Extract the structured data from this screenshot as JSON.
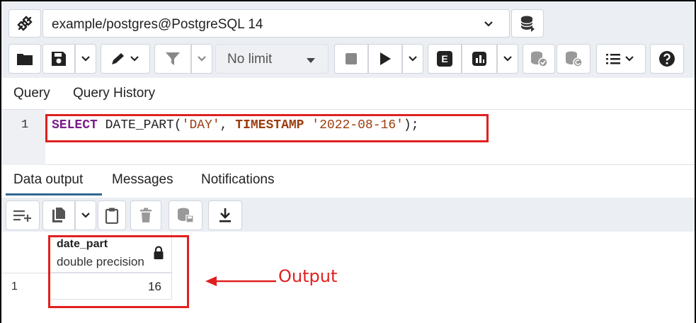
{
  "connection": {
    "label": "example/postgres@PostgreSQL 14",
    "icons": {
      "plug": "disconnect-plug-icon",
      "chevron": "chevron-down-icon",
      "db": "database-icon"
    }
  },
  "toolbar": {
    "limit_label": "No limit",
    "icons": [
      "folder-icon",
      "save-icon",
      "chevron-down-icon",
      "edit-pen-icon",
      "filter-icon",
      "stop-icon",
      "play-icon",
      "explain-icon",
      "explain-analyze-icon",
      "commit-icon",
      "rollback-icon",
      "macros-icon",
      "help-icon"
    ],
    "explain_label": "E"
  },
  "query_tabs": {
    "query": "Query",
    "history": "Query History"
  },
  "editor": {
    "line_number": "1",
    "sql": {
      "select_kw": "SELECT",
      "fn": " DATE_PART(",
      "arg1": "'DAY'",
      "comma": ", ",
      "ts_kw": "TIMESTAMP",
      "space": " ",
      "arg2": "'2022-08-16'",
      "close": ");"
    }
  },
  "result_tabs": {
    "data_output": "Data output",
    "messages": "Messages",
    "notifications": "Notifications"
  },
  "result_toolbar": {
    "icons": [
      "add-row-icon",
      "copy-icon",
      "chevron-down-icon",
      "paste-icon",
      "delete-icon",
      "save-data-icon",
      "download-icon"
    ]
  },
  "grid": {
    "column": {
      "name": "date_part",
      "type": "double precision"
    },
    "rows": [
      {
        "row_no": "1",
        "value": "16"
      }
    ]
  },
  "annotation": {
    "label": "Output"
  },
  "colors": {
    "highlight": "#e02020",
    "accent": "#326690",
    "toolbar_bg": "#ebeef3"
  }
}
